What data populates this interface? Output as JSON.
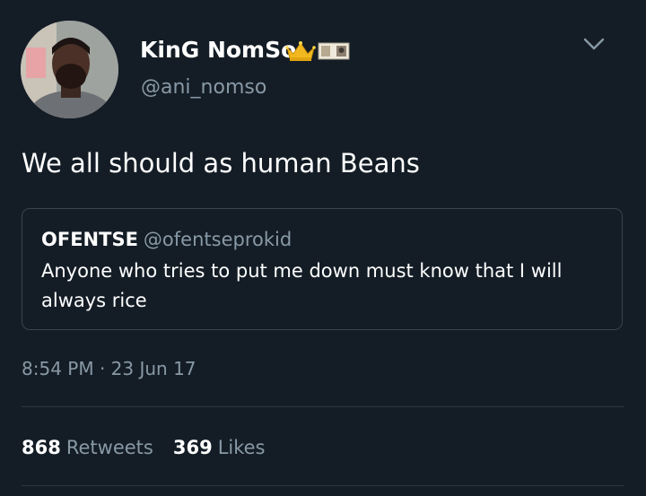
{
  "tweet": {
    "display_name": "KinG NomSo",
    "name_emojis": [
      "crown-emoji",
      "currency-emoji"
    ],
    "handle": "@ani_nomso",
    "text": "We all should as human Beans",
    "timestamp": "8:54 PM · 23 Jun 17",
    "retweets_count": "868",
    "retweets_label": "Retweets",
    "likes_count": "369",
    "likes_label": "Likes"
  },
  "quoted_tweet": {
    "name": "OFENTSE",
    "handle": "@ofentseprokid",
    "text": "Anyone who tries to put me down must know that I will always rice"
  },
  "colors": {
    "background": "#141d26",
    "text_primary": "#ffffff",
    "text_secondary": "#8899a6",
    "border": "#38444d"
  }
}
